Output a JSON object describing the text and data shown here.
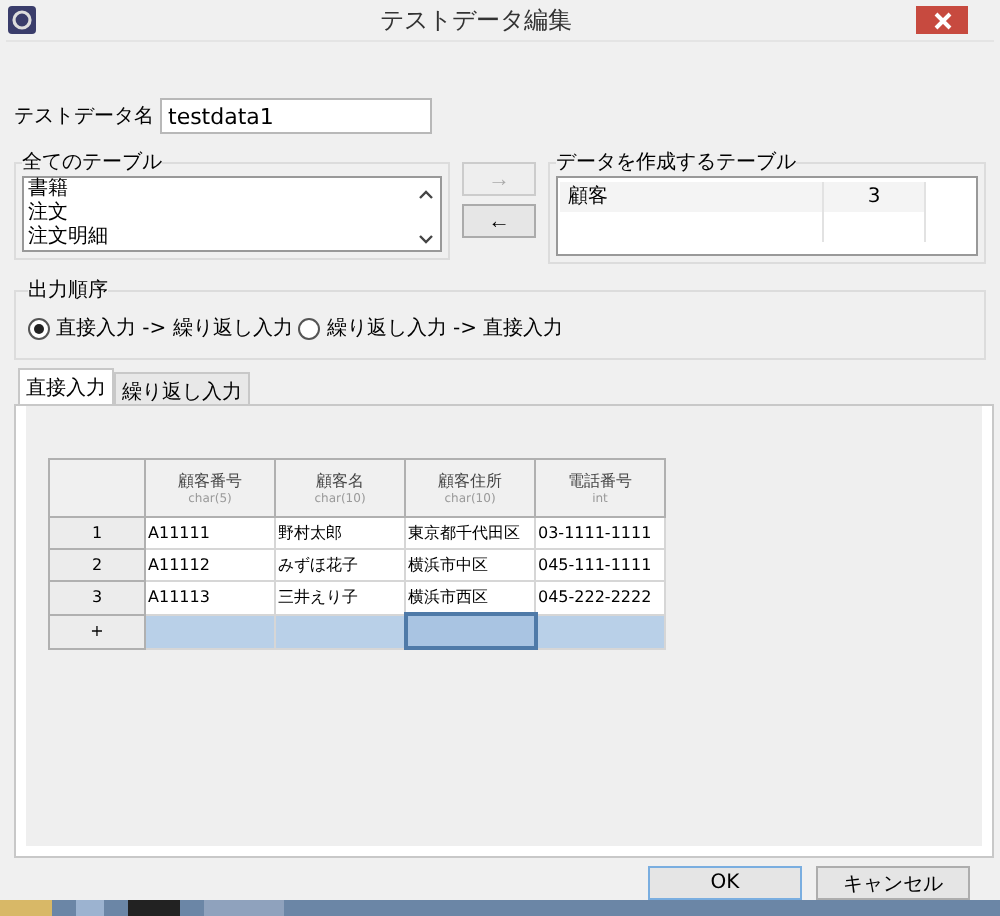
{
  "window": {
    "title": "テストデータ編集"
  },
  "name_field": {
    "label": "テストデータ名",
    "value": "testdata1"
  },
  "all_tables": {
    "title": "全てのテーブル",
    "items": [
      "書籍",
      "注文",
      "注文明細"
    ]
  },
  "move_buttons": [
    {
      "label": "→",
      "disabled": true
    },
    {
      "label": "←",
      "disabled": false
    }
  ],
  "target_tables": {
    "title": "データを作成するテーブル",
    "rows": [
      {
        "name": "顧客",
        "count": "3"
      }
    ]
  },
  "output_order": {
    "title": "出力順序",
    "options": [
      {
        "label": "直接入力 -> 繰り返し入力",
        "selected": true
      },
      {
        "label": "繰り返し入力 -> 直接入力",
        "selected": false
      }
    ]
  },
  "tabs": [
    {
      "label": "直接入力",
      "selected": true
    },
    {
      "label": "繰り返し入力",
      "selected": false
    }
  ],
  "table": {
    "columns": [
      {
        "name": "顧客番号",
        "type": "char(5)"
      },
      {
        "name": "顧客名",
        "type": "char(10)"
      },
      {
        "name": "顧客住所",
        "type": "char(10)"
      },
      {
        "name": "電話番号",
        "type": "int"
      }
    ],
    "rows": [
      {
        "label": "1",
        "cells": [
          "A11111",
          "野村太郎",
          "東京都千代田区",
          "03-1111-1111"
        ]
      },
      {
        "label": "2",
        "cells": [
          "A11112",
          "みずほ花子",
          "横浜市中区",
          "045-111-1111"
        ]
      },
      {
        "label": "3",
        "cells": [
          "A11113",
          "三井えり子",
          "横浜市西区",
          "045-222-2222"
        ]
      }
    ],
    "new_row": {
      "label": "+",
      "cells": [
        {
          "selected": false
        },
        {
          "selected": false
        },
        {
          "selected": true
        },
        {
          "selected": false
        }
      ]
    }
  },
  "buttons": [
    {
      "label": "OK",
      "default": true
    },
    {
      "label": "キャンセル",
      "default": false
    }
  ]
}
